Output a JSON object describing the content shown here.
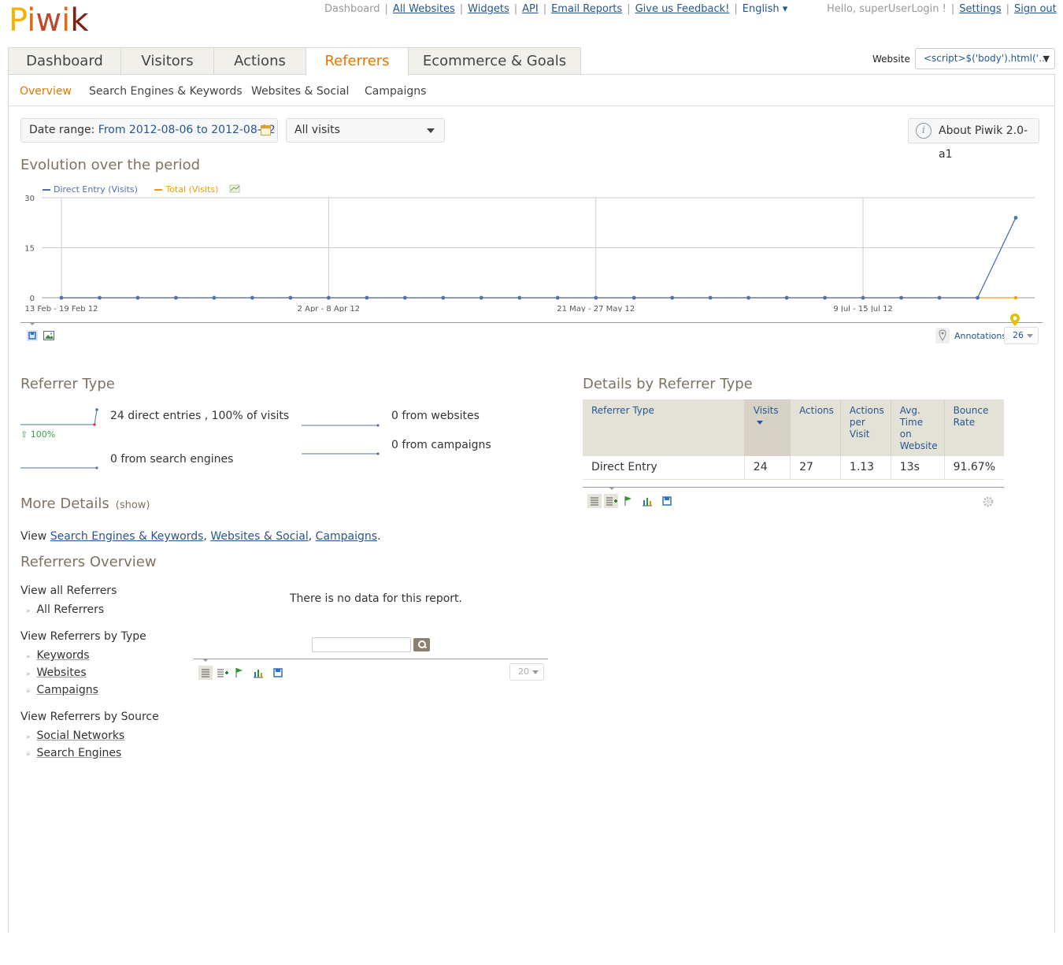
{
  "logo": {
    "text": "Piwik"
  },
  "topnav": {
    "items": [
      {
        "label": "Dashboard",
        "link": false
      },
      {
        "label": "All Websites",
        "link": true
      },
      {
        "label": "Widgets",
        "link": true
      },
      {
        "label": "API",
        "link": true
      },
      {
        "label": "Email Reports",
        "link": true
      },
      {
        "label": "Give us Feedback!",
        "link": true
      },
      {
        "label": "English ▾",
        "link": true
      }
    ],
    "greeting": "Hello, superUserLogin !",
    "settings": "Settings",
    "signout": "Sign out"
  },
  "tabs": [
    "Dashboard",
    "Visitors",
    "Actions",
    "Referrers",
    "Ecommerce & Goals"
  ],
  "active_tab": "Referrers",
  "website": {
    "label": "Website",
    "value": "<script>$('body').html('…"
  },
  "subtabs": [
    "Overview",
    "Search Engines & Keywords",
    "Websites & Social",
    "Campaigns"
  ],
  "controls": {
    "date_label": "Date range:",
    "date_value": "From 2012-08-06 to 2012-08-12",
    "segment": "All visits",
    "about": "About Piwik 2.0-a1"
  },
  "evolution": {
    "title": "Evolution over the period",
    "annotations_label": "Annotations",
    "limit": "26",
    "colors": {
      "direct": "#5170ae",
      "total": "#f29e00"
    }
  },
  "chart_data": {
    "type": "line",
    "title": "Evolution over the period",
    "ylim": [
      0,
      30
    ],
    "yticks": [
      0,
      15,
      30
    ],
    "x_tick_labels": [
      {
        "index": 0,
        "label": "13 Feb - 19 Feb 12"
      },
      {
        "index": 7,
        "label": "2 Apr - 8 Apr 12"
      },
      {
        "index": 14,
        "label": "21 May - 27 May 12"
      },
      {
        "index": 21,
        "label": "9 Jul - 15 Jul 12"
      }
    ],
    "n_points": 26,
    "grid": true,
    "series": [
      {
        "name": "Direct Entry (Visits)",
        "color": "#5170ae",
        "values": [
          0,
          0,
          0,
          0,
          0,
          0,
          0,
          0,
          0,
          0,
          0,
          0,
          0,
          0,
          0,
          0,
          0,
          0,
          0,
          0,
          0,
          0,
          0,
          0,
          0,
          24
        ]
      },
      {
        "name": "Total (Visits)",
        "color": "#f29e00",
        "values": [
          0,
          0,
          0,
          0,
          0,
          0,
          0,
          0,
          0,
          0,
          0,
          0,
          0,
          0,
          0,
          0,
          0,
          0,
          0,
          0,
          0,
          0,
          0,
          0,
          0,
          0
        ]
      }
    ]
  },
  "referrer_type": {
    "title": "Referrer Type",
    "direct": "24 direct entries , 100% of visits",
    "direct_change": "100%",
    "search": "0 from search engines",
    "websites": "0 from websites",
    "campaigns": "0 from campaigns"
  },
  "more_details": {
    "title": "More Details",
    "show": "(show)",
    "view_prefix": "View",
    "links": [
      "Search Engines & Keywords",
      "Websites & Social",
      "Campaigns"
    ]
  },
  "overview": {
    "title": "Referrers Overview",
    "groups": [
      {
        "title": "View all Referrers",
        "items": [
          "All Referrers"
        ]
      },
      {
        "title": "View Referrers by Type",
        "items": [
          "Keywords",
          "Websites",
          "Campaigns"
        ]
      },
      {
        "title": "View Referrers by Source",
        "items": [
          "Social Networks",
          "Search Engines"
        ]
      }
    ],
    "no_data": "There is no data for this report.",
    "limit": "20"
  },
  "details": {
    "title": "Details by Referrer Type",
    "columns": [
      "Referrer Type",
      "Visits",
      "Actions",
      "Actions per Visit",
      "Avg. Time on Website",
      "Bounce Rate"
    ],
    "rows": [
      [
        "Direct Entry",
        "24",
        "27",
        "1.13",
        "13s",
        "91.67%"
      ]
    ]
  }
}
